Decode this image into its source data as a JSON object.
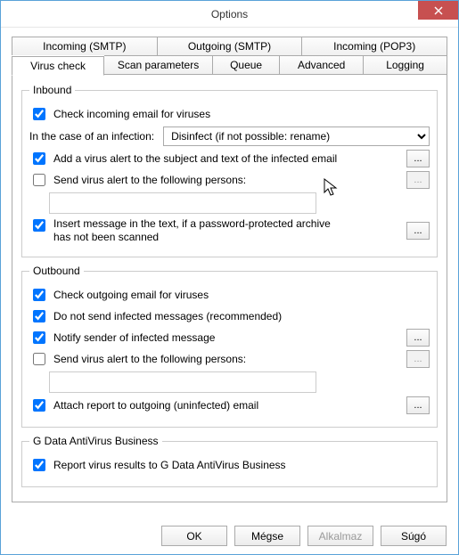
{
  "window": {
    "title": "Options"
  },
  "tabs": {
    "row1": [
      "Incoming (SMTP)",
      "Outgoing (SMTP)",
      "Incoming (POP3)"
    ],
    "row2": [
      "Virus check",
      "Scan parameters",
      "Queue",
      "Advanced",
      "Logging"
    ],
    "active": "Virus check"
  },
  "inbound": {
    "legend": "Inbound",
    "check_incoming": "Check incoming email for viruses",
    "infection_label": "In the case of an infection:",
    "infection_selected": "Disinfect (if not possible: rename)",
    "add_virus_alert": "Add a virus alert to the subject and text of the infected email",
    "send_alert_persons": "Send virus alert to the following persons:",
    "persons_value": "",
    "insert_message": "Insert message in the text, if a password-protected archive has not been scanned",
    "check_incoming_checked": true,
    "add_virus_alert_checked": true,
    "send_alert_persons_checked": false,
    "insert_message_checked": true
  },
  "outbound": {
    "legend": "Outbound",
    "check_outgoing": "Check outgoing email for viruses",
    "do_not_send": "Do not send infected messages (recommended)",
    "notify_sender": "Notify sender of infected message",
    "send_alert_persons": "Send virus alert to the following persons:",
    "persons_value": "",
    "attach_report": "Attach report to outgoing (uninfected) email",
    "check_outgoing_checked": true,
    "do_not_send_checked": true,
    "notify_sender_checked": true,
    "send_alert_persons_checked": false,
    "attach_report_checked": true
  },
  "gdata": {
    "legend": "G Data AntiVirus Business",
    "report_results": "Report virus results to G Data AntiVirus Business",
    "report_results_checked": true
  },
  "buttons": {
    "ok": "OK",
    "cancel": "Mégse",
    "apply": "Alkalmaz",
    "help": "Súgó"
  }
}
